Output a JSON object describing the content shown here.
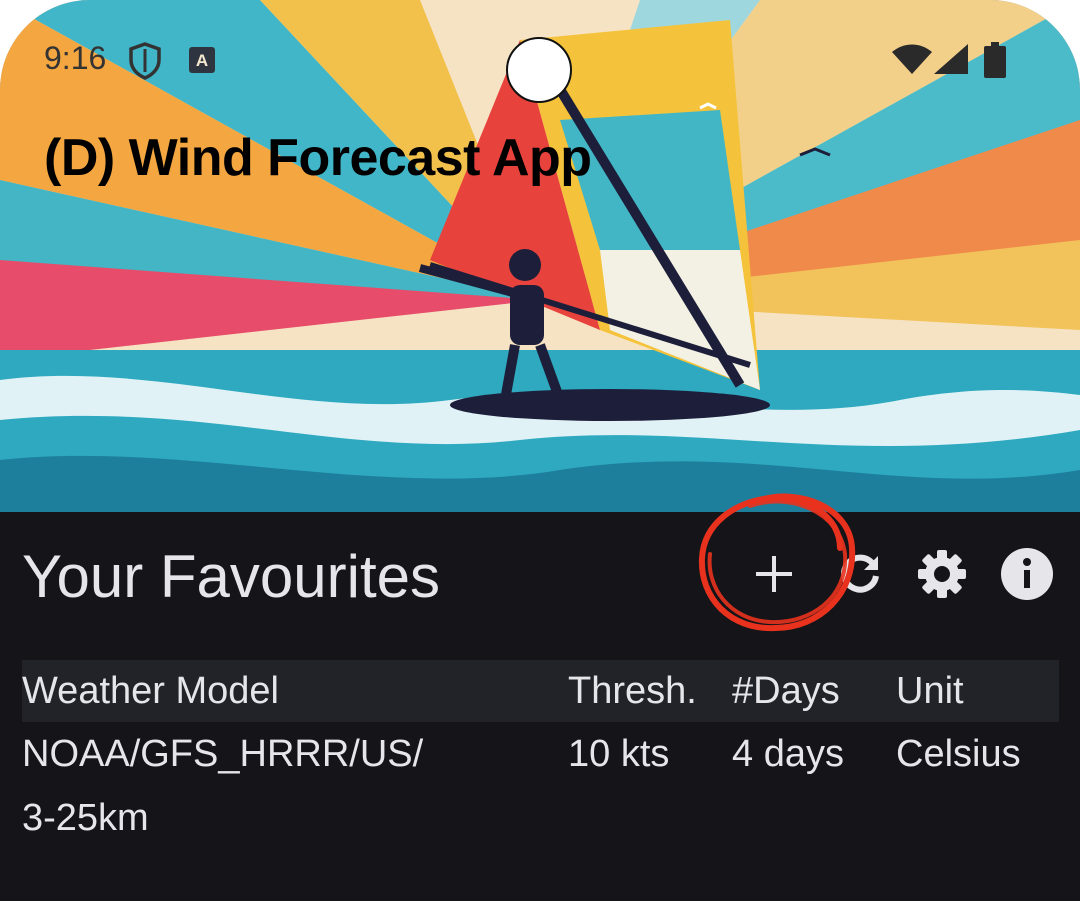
{
  "status_bar": {
    "time": "9:16",
    "icons": [
      "shield-icon",
      "accessibility-a-icon",
      "wifi-icon",
      "cellular-signal-icon",
      "battery-icon"
    ]
  },
  "app": {
    "title": "(D) Wind Forecast App"
  },
  "favourites": {
    "title": "Your Favourites",
    "actions": [
      {
        "name": "add",
        "icon": "plus-icon"
      },
      {
        "name": "refresh",
        "icon": "refresh-icon"
      },
      {
        "name": "settings",
        "icon": "gear-icon"
      },
      {
        "name": "info",
        "icon": "info-icon"
      }
    ],
    "table": {
      "headers": [
        "Weather Model",
        "Thresh.",
        "#Days",
        "Unit"
      ],
      "rows": [
        {
          "model_line1": "NOAA/GFS_HRRR/US/",
          "model_line2": "3-25km",
          "threshold": "10 kts",
          "days": "4 days",
          "unit": "Celsius"
        }
      ]
    }
  },
  "colors": {
    "background": "#141419",
    "header_row": "#212329",
    "text": "#e6e6ea",
    "annotation": "#e8321e"
  }
}
